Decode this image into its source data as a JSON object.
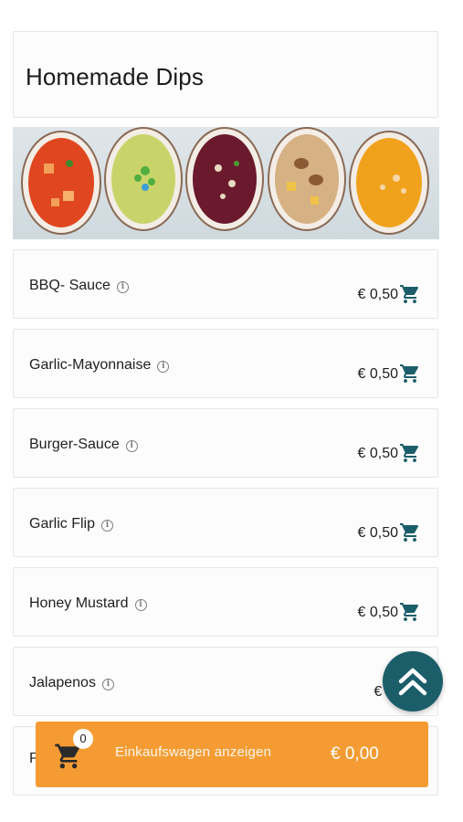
{
  "category": {
    "title": "Homemade Dips"
  },
  "items": [
    {
      "name": "BBQ- Sauce",
      "price": "€ 0,50"
    },
    {
      "name": "Garlic-Mayonnaise",
      "price": "€ 0,50"
    },
    {
      "name": "Burger-Sauce",
      "price": "€ 0,50"
    },
    {
      "name": "Garlic Flip",
      "price": "€ 0,50"
    },
    {
      "name": "Honey Mustard",
      "price": "€ 0,50"
    },
    {
      "name": "Jalapenos",
      "price": "€ 0,"
    },
    {
      "name": "P",
      "price": ""
    }
  ],
  "icons": {
    "info": "info-icon",
    "cart": "cart-icon",
    "scroll_top": "double-chevron-up-icon"
  },
  "cart": {
    "count": "0",
    "label": "Einkaufswagen anzeigen",
    "total": "€ 0,00"
  },
  "colors": {
    "accent_teal": "#1b5e6a",
    "cart_orange": "#f49c33"
  }
}
